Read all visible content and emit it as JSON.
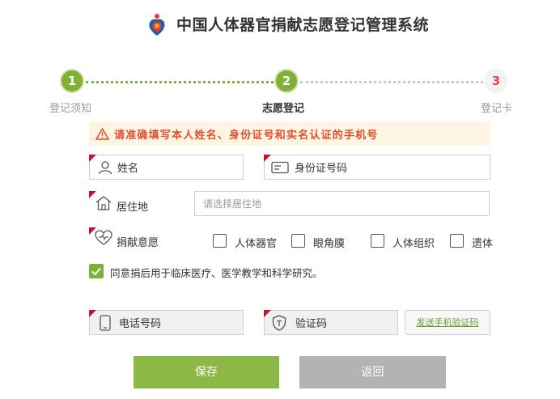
{
  "header": {
    "title": "中国人体器官捐献志愿登记管理系统"
  },
  "steps": [
    {
      "number": "1",
      "label": "登记须知"
    },
    {
      "number": "2",
      "label": "志愿登记"
    },
    {
      "number": "3",
      "label": "登记卡"
    }
  ],
  "warning": {
    "text": "请准确填写本人姓名、身份证号和实名认证的手机号"
  },
  "form": {
    "name_label": "姓名",
    "id_label": "身份证号码",
    "residence_label": "居住地",
    "residence_placeholder": "请选择居住地",
    "intent_label": "捐献意愿",
    "intent_options": [
      "人体器官",
      "眼角膜",
      "人体组织",
      "遗体"
    ],
    "agree_text": "同意捐后用于临床医疗、医学教学和科学研究。",
    "phone_label": "电话号码",
    "code_label": "验证码",
    "send_code_label": "发送手机验证码"
  },
  "buttons": {
    "save": "保存",
    "back": "返回"
  },
  "colors": {
    "accent_green": "#8cb945",
    "required_red": "#c8102e",
    "warning_text": "#e0502e"
  },
  "icons": [
    "logo-icon",
    "warning-icon",
    "user-icon",
    "id-card-icon",
    "home-icon",
    "heart-icon",
    "check-icon",
    "phone-icon",
    "shield-icon"
  ]
}
